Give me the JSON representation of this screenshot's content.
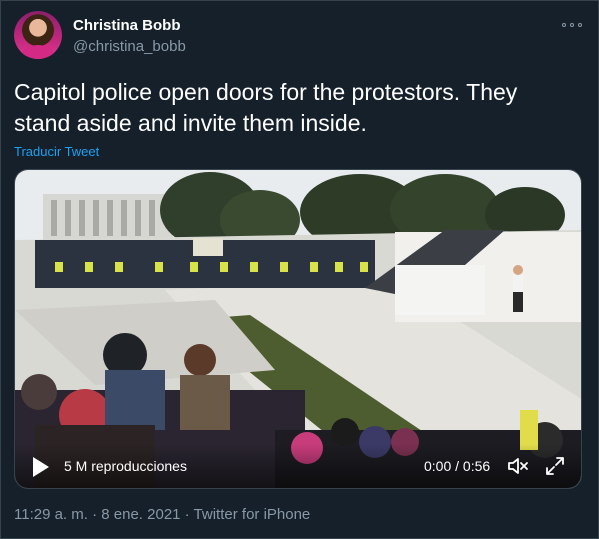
{
  "author": {
    "name": "Christina Bobb",
    "handle": "@christina_bobb",
    "avatar_icon": "profile-photo"
  },
  "tweet": {
    "text": "Capitol police open doors for the protestors.  They stand aside and invite them inside.",
    "translate_label": "Traducir Tweet"
  },
  "video": {
    "views": "5 M reproducciones",
    "time": "0:00 / 0:56",
    "play_icon": "play-icon",
    "volume_icon": "volume-icon",
    "fullscreen_icon": "fullscreen-icon"
  },
  "meta": {
    "line": "11:29 a. m. · 8 ene. 2021 · Twitter for iPhone"
  },
  "colors": {
    "background": "#15202b",
    "link": "#1da1f2",
    "secondary_text": "#8899a6",
    "border": "#38444d"
  }
}
